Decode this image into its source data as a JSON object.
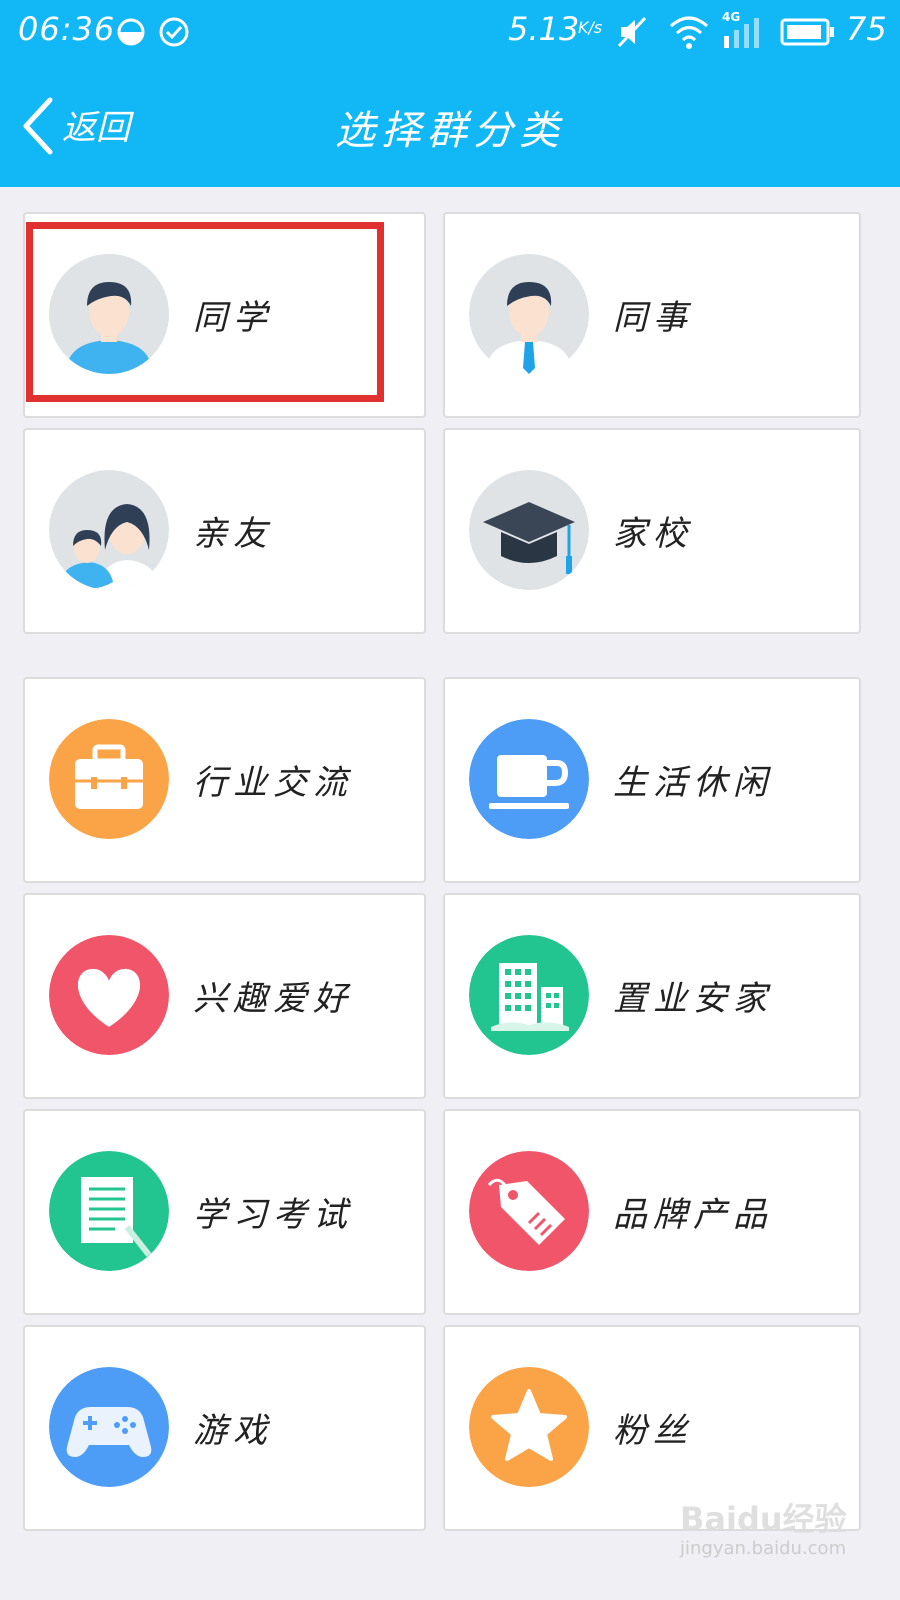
{
  "status_bar": {
    "time": "06:36",
    "network_speed": "5.13",
    "speed_unit": "K/s",
    "network_type": "4G",
    "battery": "75"
  },
  "header": {
    "back_label": "返回",
    "title": "选择群分类"
  },
  "categories": [
    {
      "label": "同学",
      "icon": "student-avatar-icon",
      "color": "#dfe3e6"
    },
    {
      "label": "同事",
      "icon": "colleague-avatar-icon",
      "color": "#dfe3e6"
    },
    {
      "label": "亲友",
      "icon": "family-avatar-icon",
      "color": "#dfe3e6"
    },
    {
      "label": "家校",
      "icon": "graduation-cap-icon",
      "color": "#dfe3e6"
    },
    {
      "label": "行业交流",
      "icon": "briefcase-icon",
      "color": "#fba347"
    },
    {
      "label": "生活休闲",
      "icon": "coffee-cup-icon",
      "color": "#4d9cf5"
    },
    {
      "label": "兴趣爱好",
      "icon": "heart-icon",
      "color": "#f0556a"
    },
    {
      "label": "置业安家",
      "icon": "buildings-icon",
      "color": "#22c48f"
    },
    {
      "label": "学习考试",
      "icon": "notepad-icon",
      "color": "#22c48f"
    },
    {
      "label": "品牌产品",
      "icon": "price-tag-icon",
      "color": "#f0556a"
    },
    {
      "label": "游戏",
      "icon": "gamepad-icon",
      "color": "#4d9cf5"
    },
    {
      "label": "粉丝",
      "icon": "star-icon",
      "color": "#fba347"
    }
  ],
  "watermark": {
    "text": "Baidu经验",
    "url": "jingyan.baidu.com"
  }
}
